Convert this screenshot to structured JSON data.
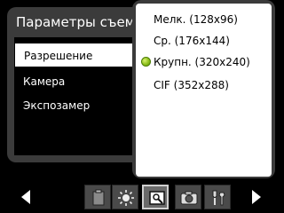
{
  "panel": {
    "title": "Параметры съемки",
    "items": [
      {
        "label": "Разрешение"
      },
      {
        "label": "Камера"
      },
      {
        "label": "Экспозамер"
      }
    ]
  },
  "dropdown": {
    "options": [
      {
        "label": "Мелк. (128x96)",
        "selected": false
      },
      {
        "label": "Ср. (176x144)",
        "selected": false
      },
      {
        "label": "Крупн. (320x240)",
        "selected": true
      },
      {
        "label": "CIF (352x288)",
        "selected": false
      }
    ]
  },
  "toolbar": {
    "icons": [
      "document-icon",
      "brightness-icon",
      "capture-mode-icon",
      "camera-icon",
      "tools-icon"
    ]
  },
  "colors": {
    "panel_bg": "#3b3b3b",
    "selected_dot": "#8cbf1a"
  }
}
